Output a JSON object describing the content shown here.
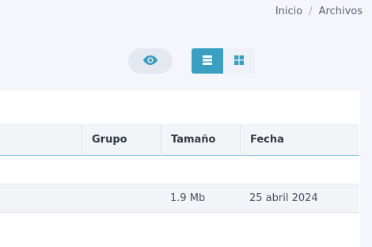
{
  "breadcrumb": {
    "home": "Inicio",
    "separator": "/",
    "current": "Archivos"
  },
  "toolbar": {
    "preview_icon": "eye-icon",
    "views": [
      {
        "icon": "list-icon",
        "active": true
      },
      {
        "icon": "grid-icon",
        "active": false
      }
    ]
  },
  "table": {
    "columns": [
      "",
      "Grupo",
      "Tamaño",
      "Fecha"
    ],
    "rows": [
      {
        "name": "",
        "group": "",
        "size": "1.9 Mb",
        "date": "25 abril 2024"
      }
    ]
  },
  "colors": {
    "accent": "#3a9fc1",
    "background": "#f4f6fc",
    "panel": "#ffffff",
    "header_bg": "#f3f4f8"
  }
}
